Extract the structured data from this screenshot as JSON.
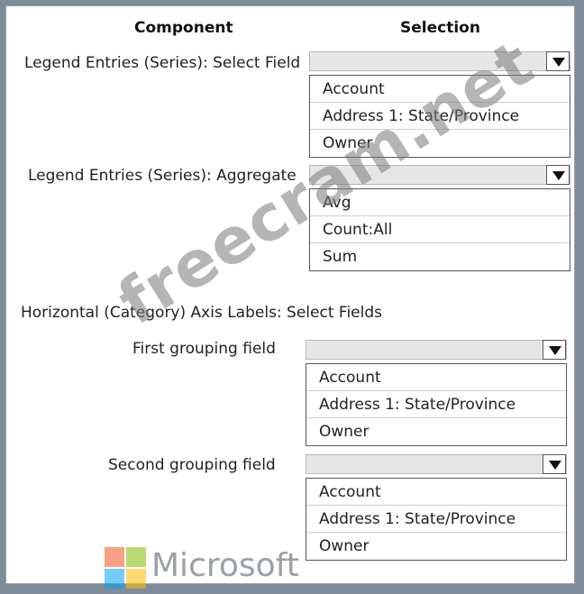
{
  "headers": {
    "component": "Component",
    "selection": "Selection"
  },
  "rows": [
    {
      "label": "Legend Entries (Series): Select Field",
      "options": [
        "Account",
        "Address 1: State/Province",
        "Owner"
      ]
    },
    {
      "label": "Legend Entries (Series): Aggregate",
      "options": [
        "Avg",
        "Count:All",
        "Sum"
      ]
    },
    {
      "label": "First grouping field",
      "options": [
        "Account",
        "Address 1: State/Province",
        "Owner"
      ]
    },
    {
      "label": "Second grouping field",
      "options": [
        "Account",
        "Address 1: State/Province",
        "Owner"
      ]
    }
  ],
  "section_label": "Horizontal (Category) Axis Labels: Select Fields",
  "watermark": "freecram.net",
  "brand": {
    "name": "Microsoft",
    "colors": [
      "#f25022",
      "#7fba00",
      "#00a4ef",
      "#ffb900"
    ]
  }
}
